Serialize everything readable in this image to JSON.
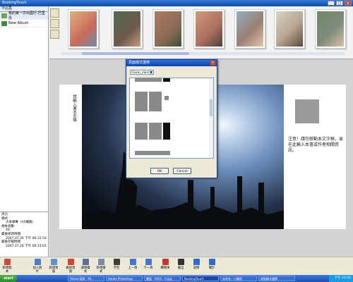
{
  "app": {
    "title": "BookingTouch",
    "window_buttons": [
      "_",
      "□",
      "×"
    ]
  },
  "left_panel": {
    "header": "作品集",
    "albums": [
      {
        "label": "我的第一次出國行-巴里島",
        "icon_color": "#6aa84f",
        "selected": true
      },
      {
        "label": "New Album",
        "icon_color": "#3d8b3d",
        "selected": false
      }
    ],
    "info": {
      "header": "資訊",
      "style_label": "樣式",
      "style_value": "大本摩專（A5橫版）",
      "pages_label": "相本頁數:",
      "pages_value": "40",
      "created_label": "最後修改時間",
      "created_value": "2007.07.26 下午 06:32:54",
      "modified_label": "最後存檔時間",
      "modified_value": "2007.07.26 下午 06:33:01"
    }
  },
  "thumbnail_strip": {
    "photos": [
      {
        "color": "#c86a5a"
      },
      {
        "color": "#6f5a4f"
      },
      {
        "color": "#8a6a55"
      },
      {
        "color": "#aa6e5f"
      },
      {
        "color": "#9b7f74"
      },
      {
        "color": "#b7a48f"
      },
      {
        "color": "#7f8a7a"
      }
    ]
  },
  "page": {
    "vertical_text": "請輸入書本名稱",
    "note": "注意！請勿移動本文字框，並在此輸入本書或作者相關資訊。"
  },
  "dialog": {
    "title": "頁面樣式選擇",
    "close": "×",
    "selected_style": "Cover_Hard",
    "ok_label": "OK",
    "cancel_label": "Cancel"
  },
  "toolbar": {
    "items": [
      {
        "label": "新增相本",
        "color": "#c94a3b"
      },
      {
        "label": "加入照片",
        "color": "#4d7ec9"
      },
      {
        "label": "新增頁面",
        "color": "#5f8fd4"
      },
      {
        "label": "刪除頁面",
        "color": "#d2442e"
      },
      {
        "label": "選擇樣式",
        "color": "#5b6f9a"
      },
      {
        "label": "新增樣式",
        "color": "#7b8aa6"
      },
      {
        "label": "字型",
        "color": "#3c3c3c"
      },
      {
        "label": "上一頁",
        "color": "#4477cc"
      },
      {
        "label": "下一頁",
        "color": "#4477cc"
      },
      {
        "label": "購物車",
        "color": "#c23a2a"
      },
      {
        "label": "匯出",
        "color": "#333333"
      },
      {
        "label": "說明",
        "color": "#2c6ad0"
      },
      {
        "label": "關於",
        "color": "#2c6ad0"
      }
    ]
  },
  "taskbar": {
    "start": "start",
    "tasks": [
      "Yahoo!奇摩 - Mi...",
      "Adobe Photoshop",
      "畫面 - 0001 - 0.jpg",
      "BookingTouch",
      "未命名 - 小畫家",
      "頁面樣式選擇"
    ],
    "clock": "下午 10:56"
  }
}
